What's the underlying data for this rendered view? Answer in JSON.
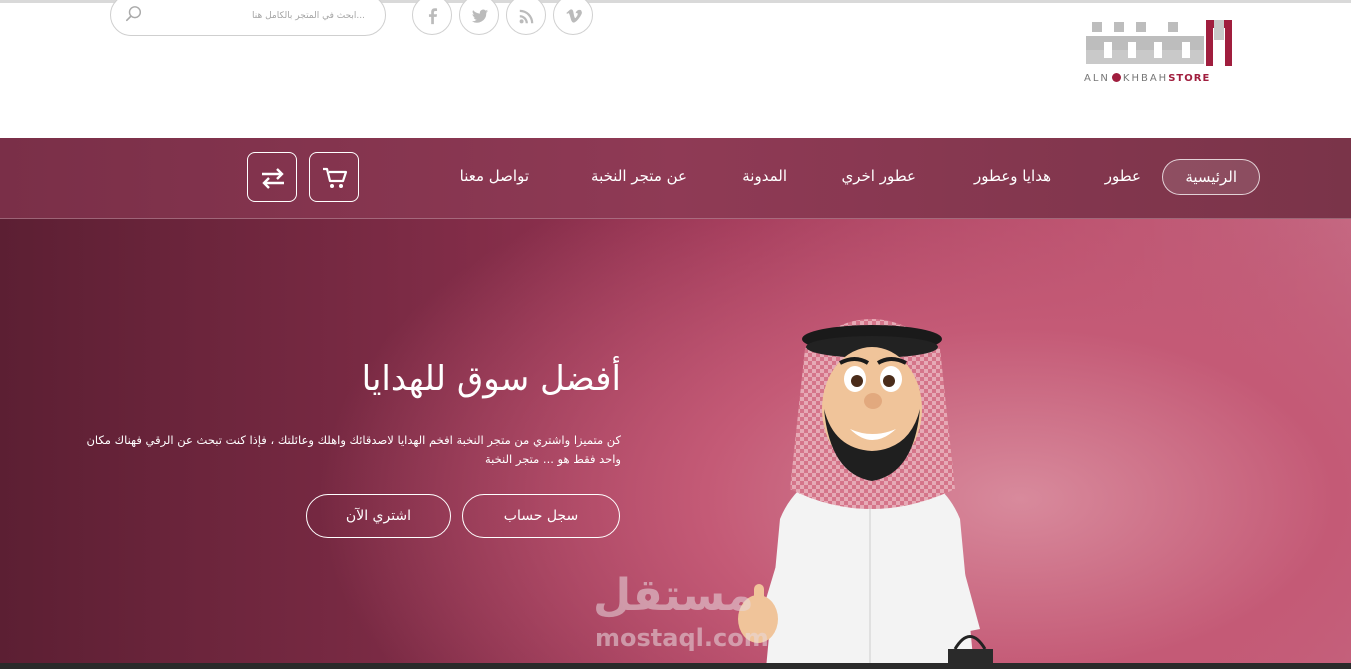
{
  "header": {
    "search_placeholder": "...ابحث في المتجر بالكامل هنا",
    "logo_text_left": "ALN",
    "logo_text_mid": "KHBAH",
    "logo_text_right": "STORE",
    "social": [
      "vimeo-icon",
      "rss-icon",
      "twitter-icon",
      "facebook-icon"
    ]
  },
  "nav": {
    "items": [
      "الرئيسية",
      "عطور",
      "هدايا وعطور",
      "عطور اخري",
      "المدونة",
      "عن متجر النخبة",
      "تواصل معنا"
    ],
    "active_index": 0
  },
  "hero": {
    "title": "أفضل سوق للهدايا",
    "description": "كن متميزا واشتري من متجر النخبة افخم الهدايا لاصدقائك واهلك وعائلتك ، فإذا كنت تبحث عن الرقي فهناك مكان واحد فقط هو ... متجر النخبة",
    "register_button": "سجل حساب",
    "buy_button": "اشتري الآن"
  },
  "watermark": {
    "arabic": "مستقل",
    "latin": "mostaql.com"
  },
  "colors": {
    "brand": "#a01e3e",
    "nav_bg": "#8a3652",
    "hero_accent": "#c45a76"
  }
}
